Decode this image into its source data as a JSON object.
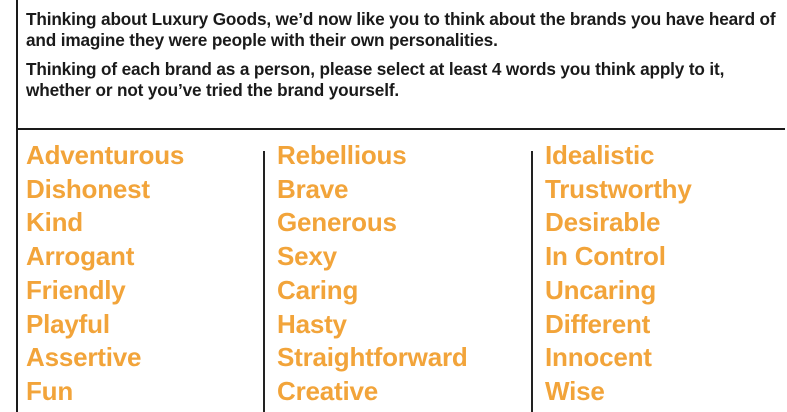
{
  "intro": {
    "paragraph1": "Thinking about Luxury Goods, we’d now like you to think about the brands you have heard of and imagine they were people with their own personalities.",
    "paragraph2": "Thinking of each brand as a person, please select at least 4 words you think apply to it, whether or not you’ve tried the brand yourself."
  },
  "words": {
    "column1": [
      "Adventurous",
      "Dishonest",
      "Kind",
      "Arrogant",
      "Friendly",
      "Playful",
      "Assertive",
      "Fun"
    ],
    "column2": [
      "Rebellious",
      "Brave",
      "Generous",
      "Sexy",
      "Caring",
      "Hasty",
      "Straightforward",
      "Creative"
    ],
    "column3": [
      "Idealistic",
      "Trustworthy",
      "Desirable",
      "In Control",
      "Uncaring",
      "Different",
      "Innocent",
      "Wise"
    ]
  },
  "colors": {
    "word_color": "#f2a43a",
    "text_color": "#1a1a1a",
    "background": "#ffffff"
  }
}
